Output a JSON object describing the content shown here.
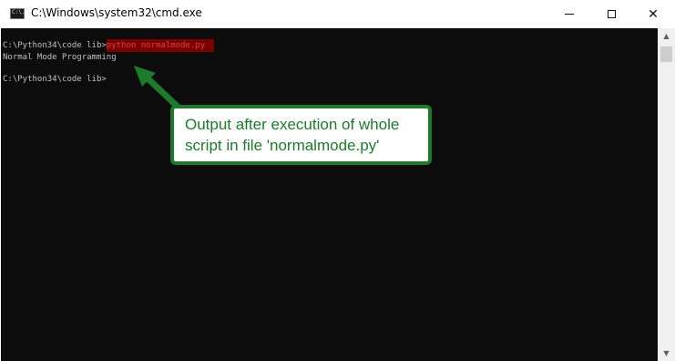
{
  "window": {
    "title": "C:\\Windows\\system32\\cmd.exe",
    "icon_prompt": "C:\\."
  },
  "titlebar_buttons": {
    "minimize": "minimize",
    "maximize": "maximize",
    "close": "✕"
  },
  "console": {
    "line1_prompt": "C:\\Python34\\code lib>",
    "line1_command": "python normalmode.py",
    "line2_output": "Normal Mode Programming",
    "line3_prompt": "C:\\Python34\\code lib>"
  },
  "callout": {
    "line1": "Output after execution of whole",
    "line2": "script in file 'normalmode.py'",
    "color": "#1d7a2b"
  },
  "colors": {
    "console_bg": "#0c0c0c",
    "console_text": "#c0c0c0",
    "highlight_bg": "#7a0000",
    "highlight_text": "#e04040"
  }
}
